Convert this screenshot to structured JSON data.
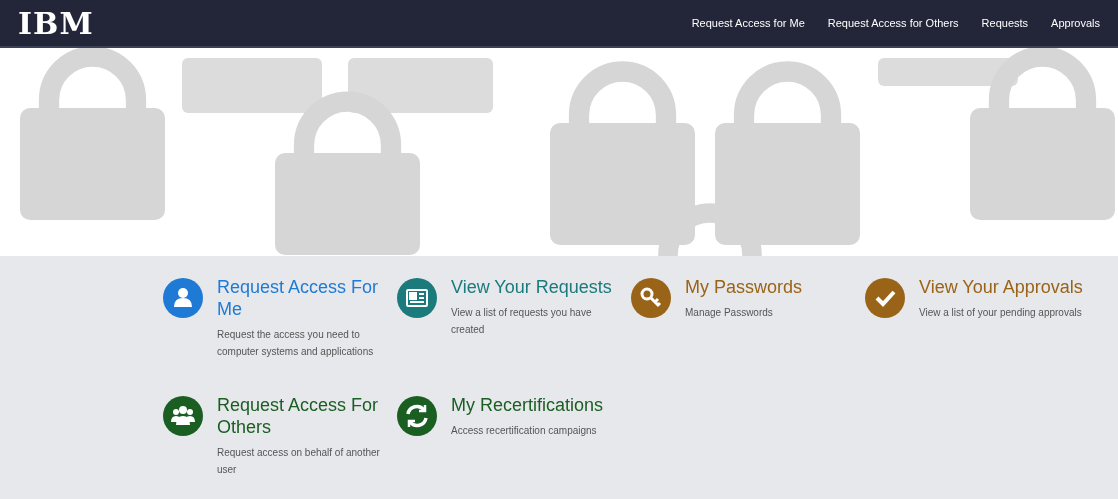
{
  "header": {
    "logo": "IBM",
    "nav": [
      {
        "label": "Request Access for Me"
      },
      {
        "label": "Request Access for Others"
      },
      {
        "label": "Requests"
      },
      {
        "label": "Approvals"
      }
    ]
  },
  "tiles": [
    {
      "kind": "user",
      "color": "#1f7ad6",
      "title": "Request Access For Me",
      "description": "Request the access you need to computer systems and applications"
    },
    {
      "kind": "card",
      "color": "#1b7a7c",
      "title": "View Your Requests",
      "description": "View a list of requests you have created"
    },
    {
      "kind": "key",
      "color": "#9a6418",
      "title": "My Passwords",
      "description": "Manage Passwords"
    },
    {
      "kind": "check",
      "color": "#9a6418",
      "title": "View Your Approvals",
      "description": "View a list of your pending approvals"
    },
    {
      "kind": "users",
      "color": "#1a5e22",
      "title": "Request Access For Others",
      "description": "Request access on behalf of another user"
    },
    {
      "kind": "refresh",
      "color": "#1a5e22",
      "title": "My Recertifications",
      "description": "Access recertification campaigns"
    }
  ]
}
